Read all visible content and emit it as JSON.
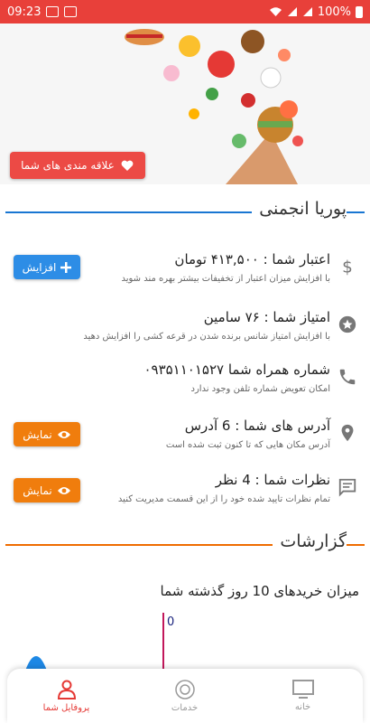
{
  "status_bar": {
    "time": "09:23",
    "battery": "100%"
  },
  "banner": {
    "favorites_label": "علاقه مندی های شما"
  },
  "profile": {
    "name": "پوریا انجمنی"
  },
  "rows": [
    {
      "title": "اعتبار شما :  ۴۱۳,۵۰۰ تومان",
      "subtitle": "با افزایش میزان اعتبار از تخفیفات بیشتر بهره مند شوید",
      "icon": "dollar-icon",
      "button": "افزایش"
    },
    {
      "title": "امتیاز شما :  ۷۶ سامین",
      "subtitle": "با افزایش امتیاز شانس برنده شدن در قرعه کشی را افزایش دهید",
      "icon": "star-icon"
    },
    {
      "title": "شماره همراه شما  ۰۹۳۵۱۱۰۱۵۲۷",
      "subtitle": "امکان تعویض شماره تلفن وجود ندارد",
      "icon": "phone-icon"
    },
    {
      "title": "آدرس های شما :  6 آدرس",
      "subtitle": "آدرس مکان هایی که تا کنون ثبت شده است",
      "icon": "location-icon",
      "button": "نمایش"
    },
    {
      "title": "نظرات شما :  4 نظر",
      "subtitle": "تمام نظرات تایید شده خود را از این قسمت مدیریت کنید",
      "icon": "comment-icon",
      "button": "نمایش"
    }
  ],
  "reports": {
    "title": "گزارشات",
    "chart_title": "میزان خریدهای 10 روز گذشته شما"
  },
  "chart_data": {
    "type": "line",
    "title": "میزان خریدهای 10 روز گذشته شما",
    "y_tick_labels": [
      "0"
    ]
  },
  "nav": {
    "profile": "پروفایل شما",
    "services": "خدمات",
    "home": "خانه"
  },
  "colors": {
    "status_bar": "#e8403a",
    "accent_blue": "#2d8de6",
    "accent_orange": "#f07d0d",
    "nav_active": "#e53935"
  }
}
